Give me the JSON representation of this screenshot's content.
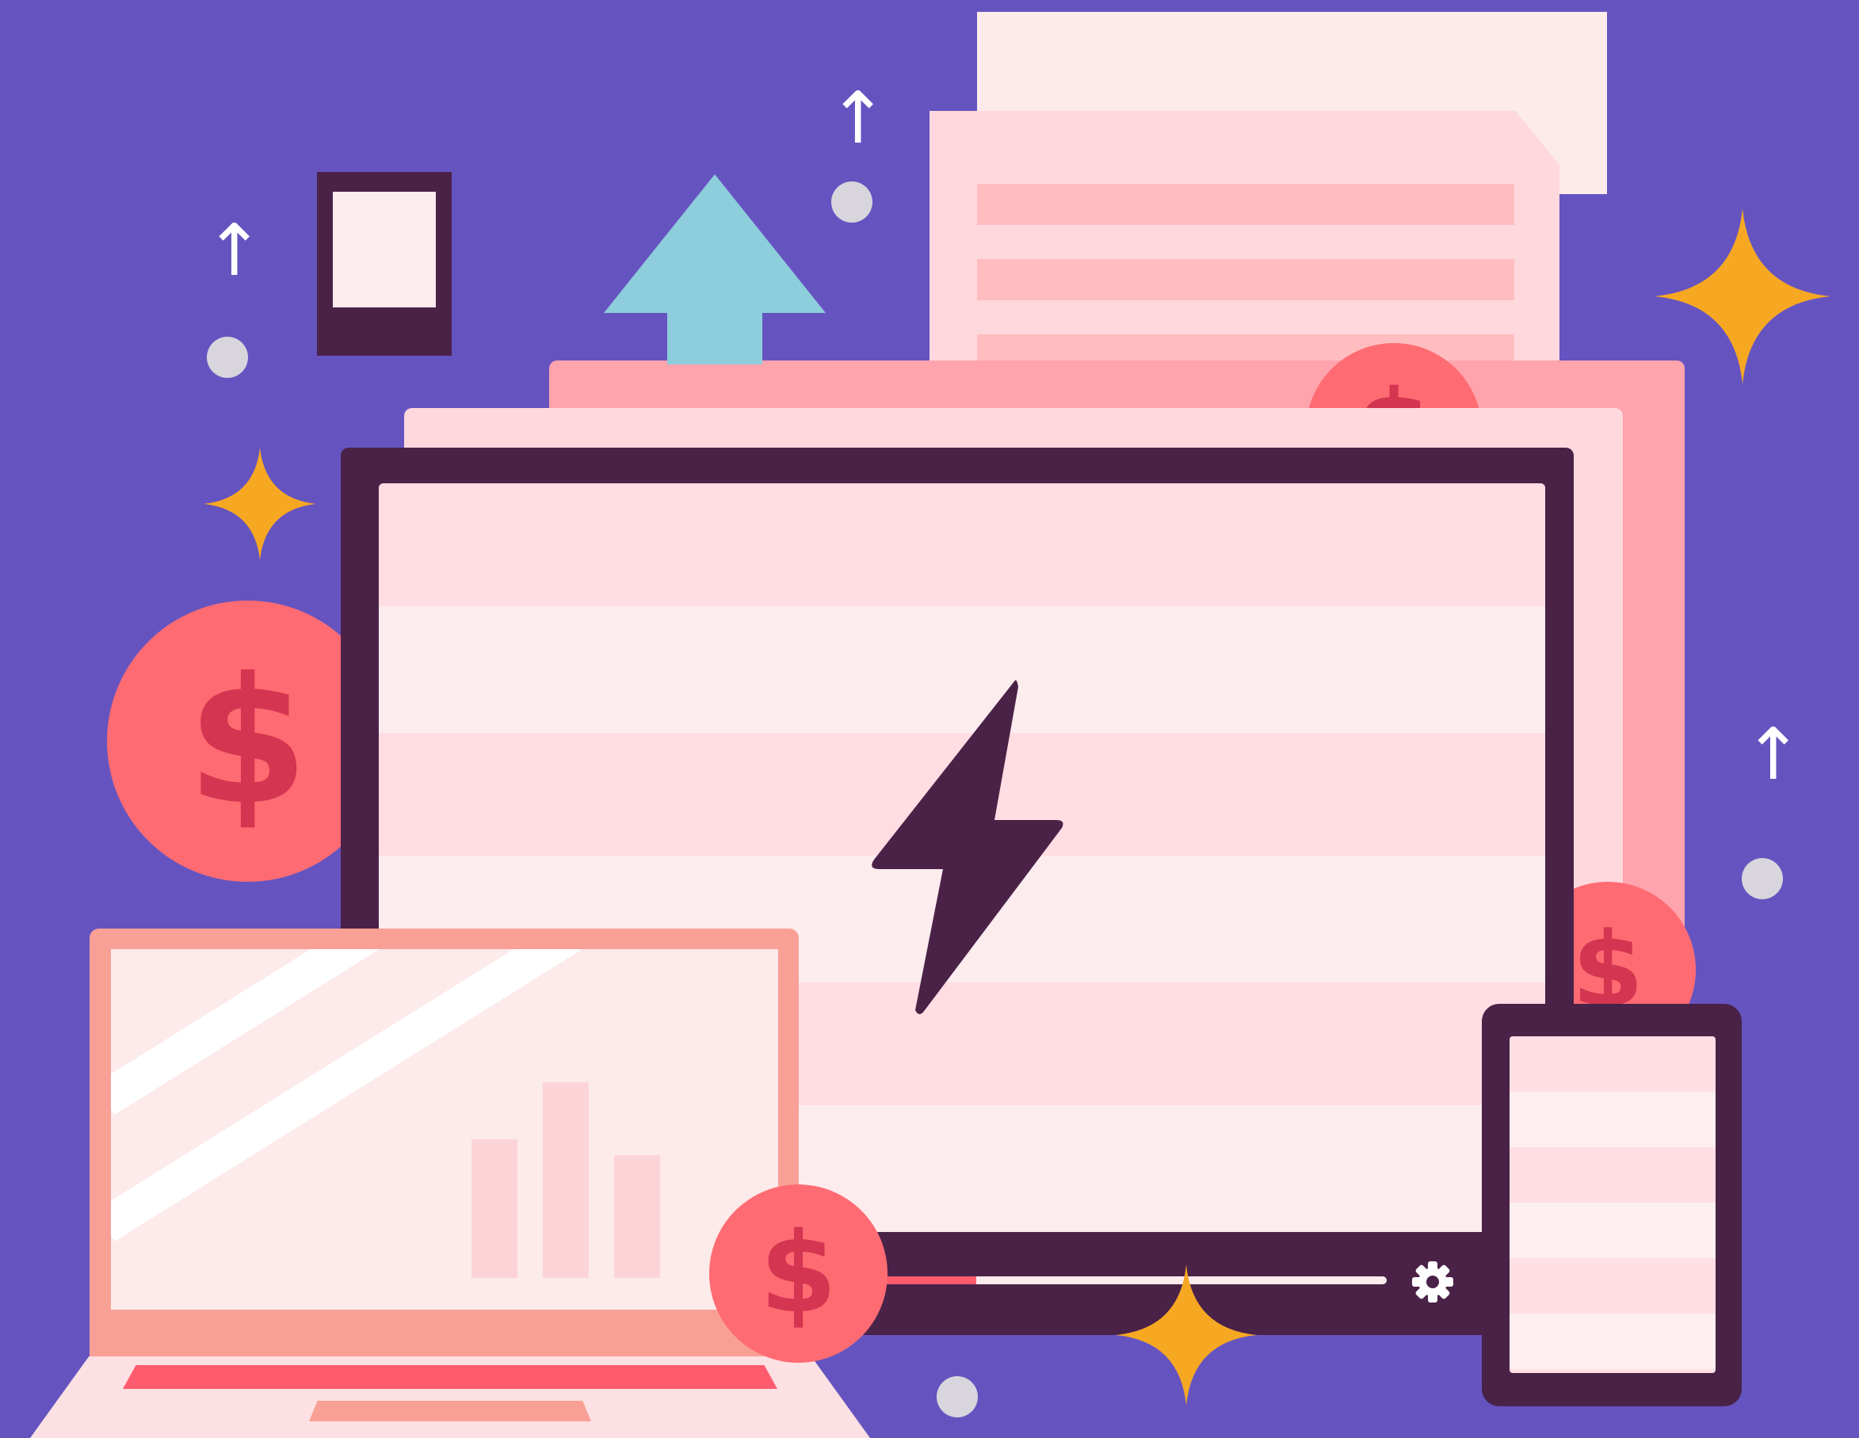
{
  "illustration": {
    "coins": [
      {
        "symbol": "$"
      },
      {
        "symbol": "$"
      },
      {
        "symbol": "$"
      },
      {
        "symbol": "$"
      }
    ],
    "upload_arrows": [
      "↑",
      "↑",
      "↑"
    ],
    "colors": {
      "background": "#6554c0",
      "coin": "#ff6b72",
      "coin_symbol": "#d43550",
      "dark_frame": "#4a2248",
      "sparkle": "#f7a823",
      "upload_arrow": "#8ecddb",
      "screen": "#fdecee"
    },
    "icons": [
      "lightning-bolt-icon",
      "gear-icon",
      "upload-arrow-icon",
      "sparkle-icon",
      "dollar-coin-icon"
    ],
    "video_progress": 0.19
  }
}
